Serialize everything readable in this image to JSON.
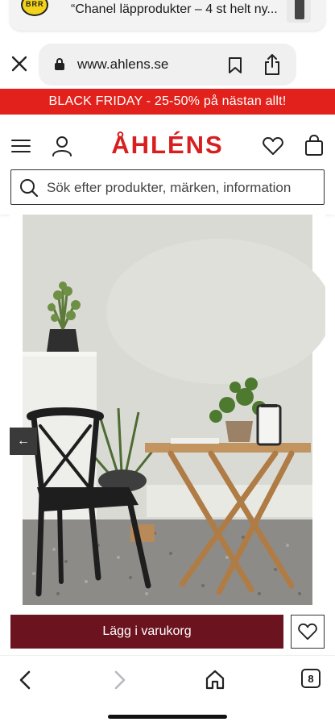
{
  "notification": {
    "logo_text": "BRR",
    "text": "“Chanel läpprodukter – 4 st helt ny..."
  },
  "browser": {
    "url": "www.ahlens.se",
    "tab_count": "8"
  },
  "promo": {
    "text": "BLACK FRIDAY - 25-50% på nästan allt!"
  },
  "header": {
    "logo": "ÅHLÉNS"
  },
  "search": {
    "placeholder": "Sök efter produkter, märken, information"
  },
  "product": {
    "image_description": "Black chair and teak folding table on gravel",
    "prev_label": "←"
  },
  "actions": {
    "add_to_cart": "Lägg i varukorg"
  },
  "colors": {
    "promo": "#e2211c",
    "brand": "#d81e1e",
    "cart_button": "#6b1420"
  }
}
